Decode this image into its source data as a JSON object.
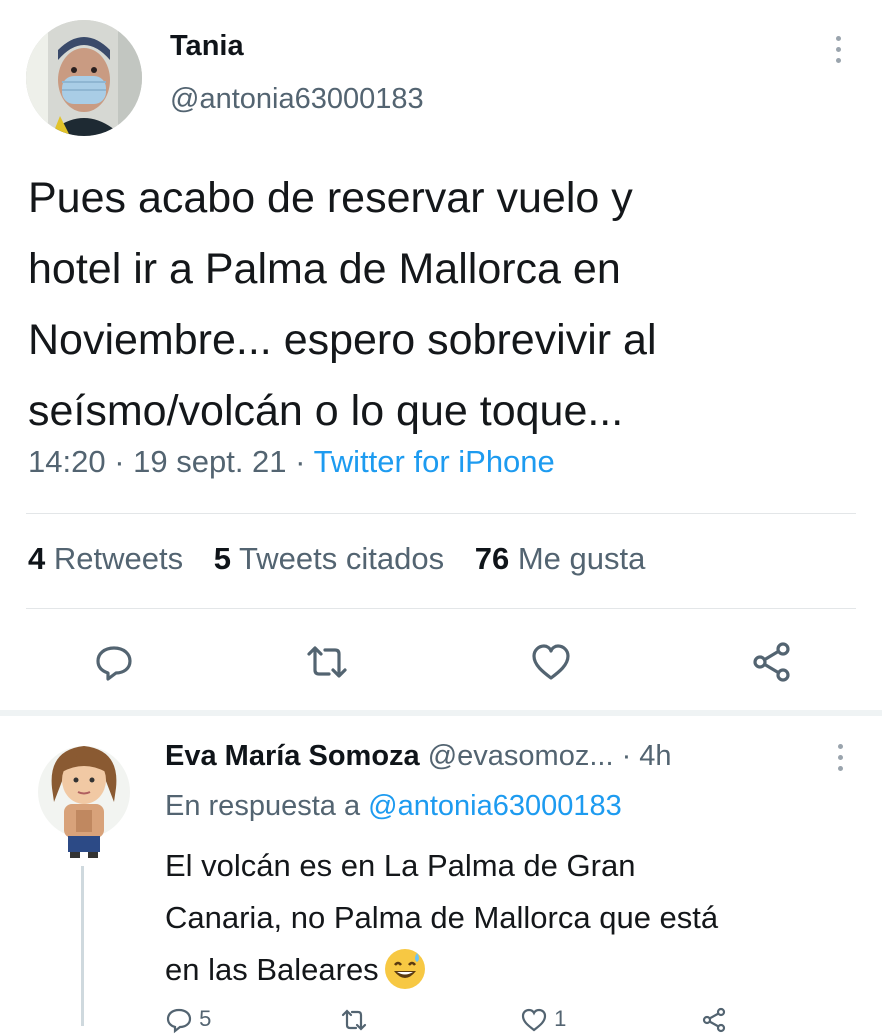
{
  "main_tweet": {
    "author_name": "Tania",
    "author_handle": "@antonia63000183",
    "text": "Pues acabo de reservar vuelo y\nhotel ir a Palma de Mallorca en\nNoviembre... espero sobrevivir al\nseísmo/volcán o lo que toque...",
    "time": "14:20",
    "date": "19 sept. 21",
    "source": "Twitter for iPhone",
    "stats": {
      "retweets_count": "4",
      "retweets_label": "Retweets",
      "quotes_count": "5",
      "quotes_label": "Tweets citados",
      "likes_count": "76",
      "likes_label": "Me gusta"
    },
    "actions": [
      "reply-icon",
      "retweet-icon",
      "like-icon",
      "share-icon"
    ]
  },
  "reply": {
    "author_name": "Eva María Somoza",
    "author_handle": "@evasomoz...",
    "time": "4h",
    "reply_to_label": "En respuesta a",
    "reply_to_handle": "@antonia63000183",
    "text": "El volcán es en La Palma de Gran\nCanaria, no Palma de Mallorca que está\nen las Baleares",
    "emoji": "sweat-smile-emoji",
    "reply_count": "5",
    "like_count": "1"
  },
  "colors": {
    "link_blue": "#1d9bf0",
    "secondary_text": "#536471",
    "primary_text": "#0f1419",
    "divider": "#e3e6e8"
  }
}
